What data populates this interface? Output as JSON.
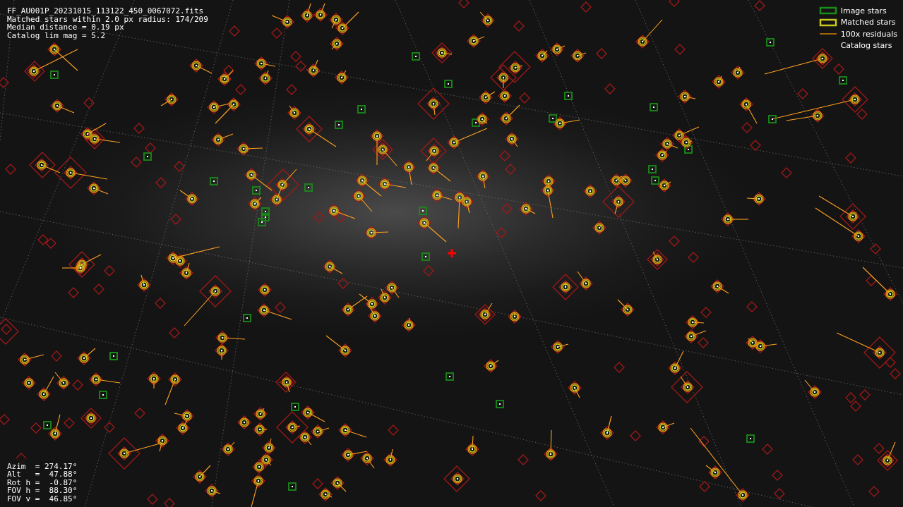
{
  "info": {
    "lines": [
      "FF_AU001P_20231015_113122_450_0067072.fits",
      "Matched stars within 2.0 px radius: 174/209",
      "Median distance = 0.19 px",
      "Catalog lim mag = 5.2"
    ]
  },
  "legend": [
    {
      "kind": "image",
      "label": "Image stars"
    },
    {
      "kind": "matched",
      "label": "Matched stars"
    },
    {
      "kind": "residual",
      "label": "100x residuals"
    },
    {
      "kind": "catalog",
      "label": "Catalog stars"
    }
  ],
  "pointing": {
    "lines": [
      "Azim  = 274.17°",
      "Alt   =  47.88°",
      "Rot h =  -0.87°",
      "FOV h =  88.30°",
      "FOV v =  46.85°"
    ]
  }
}
